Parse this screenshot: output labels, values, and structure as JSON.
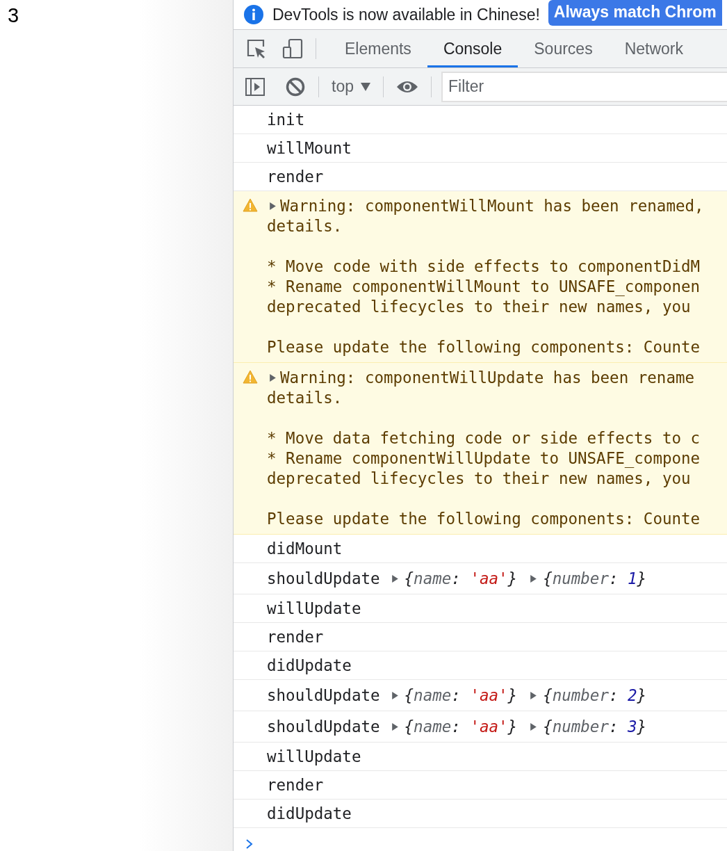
{
  "page": {
    "counter": "3"
  },
  "infobar": {
    "message": "DevTools is now available in Chinese!",
    "button": "Always match Chrom"
  },
  "tabs": [
    {
      "label": "Elements",
      "selected": false
    },
    {
      "label": "Console",
      "selected": true
    },
    {
      "label": "Sources",
      "selected": false
    },
    {
      "label": "Network",
      "selected": false
    }
  ],
  "console_toolbar": {
    "context": "top",
    "filter": {
      "placeholder": "Filter"
    }
  },
  "messages": [
    {
      "kind": "log",
      "text": "init"
    },
    {
      "kind": "log",
      "text": "willMount"
    },
    {
      "kind": "log",
      "text": "render"
    },
    {
      "kind": "warning",
      "paragraphs": [
        [
          "Warning: componentWillMount has been renamed,",
          "details."
        ],
        [
          "* Move code with side effects to componentDidM",
          "* Rename componentWillMount to UNSAFE_componen",
          "deprecated lifecycles to their new names, you"
        ],
        [
          "Please update the following components: Counte"
        ]
      ]
    },
    {
      "kind": "warning",
      "paragraphs": [
        [
          "Warning: componentWillUpdate has been rename",
          "details."
        ],
        [
          "* Move data fetching code or side effects to c",
          "* Rename componentWillUpdate to UNSAFE_compone",
          "deprecated lifecycles to their new names, you"
        ],
        [
          "Please update the following components: Counte"
        ]
      ]
    },
    {
      "kind": "log",
      "text": "didMount"
    },
    {
      "kind": "objects",
      "text": "shouldUpdate",
      "objects": [
        {
          "open": "{",
          "key": "name",
          "colon": ":",
          "value": "'aa'",
          "kind": "string",
          "close": "}"
        },
        {
          "open": "{",
          "key": "number",
          "colon": ":",
          "value": "1",
          "kind": "number",
          "close": "}"
        }
      ]
    },
    {
      "kind": "log",
      "text": "willUpdate"
    },
    {
      "kind": "log",
      "text": "render"
    },
    {
      "kind": "log",
      "text": "didUpdate"
    },
    {
      "kind": "objects",
      "text": "shouldUpdate",
      "objects": [
        {
          "open": "{",
          "key": "name",
          "colon": ":",
          "value": "'aa'",
          "kind": "string",
          "close": "}"
        },
        {
          "open": "{",
          "key": "number",
          "colon": ":",
          "value": "2",
          "kind": "number",
          "close": "}"
        }
      ]
    },
    {
      "kind": "objects",
      "text": "shouldUpdate",
      "objects": [
        {
          "open": "{",
          "key": "name",
          "colon": ":",
          "value": "'aa'",
          "kind": "string",
          "close": "}"
        },
        {
          "open": "{",
          "key": "number",
          "colon": ":",
          "value": "3",
          "kind": "number",
          "close": "}"
        }
      ]
    },
    {
      "kind": "log",
      "text": "willUpdate"
    },
    {
      "kind": "log",
      "text": "render"
    },
    {
      "kind": "log",
      "text": "didUpdate"
    }
  ]
}
